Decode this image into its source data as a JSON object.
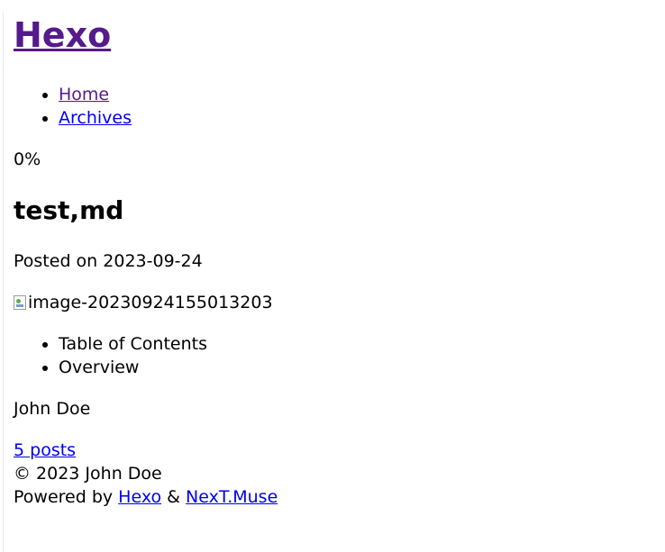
{
  "site": {
    "title": "Hexo"
  },
  "menu": {
    "items": [
      {
        "label": "Home"
      },
      {
        "label": "Archives"
      }
    ]
  },
  "reading_progress": "0%",
  "post": {
    "title": "test,md",
    "meta_prefix": "Posted on",
    "date": "2023-09-24",
    "image_alt": "image-20230924155013203"
  },
  "sidebar": {
    "tabs": [
      {
        "label": "Table of Contents"
      },
      {
        "label": "Overview"
      }
    ],
    "author": "John Doe",
    "posts_link": "5 posts"
  },
  "footer": {
    "copyright": "© 2023 John Doe",
    "powered_prefix": "Powered by",
    "hexo_link": "Hexo",
    "separator": "&",
    "theme_link": "NexT.Muse"
  },
  "colors": {
    "visited_link": "#551a8b",
    "link": "#0000ee"
  }
}
